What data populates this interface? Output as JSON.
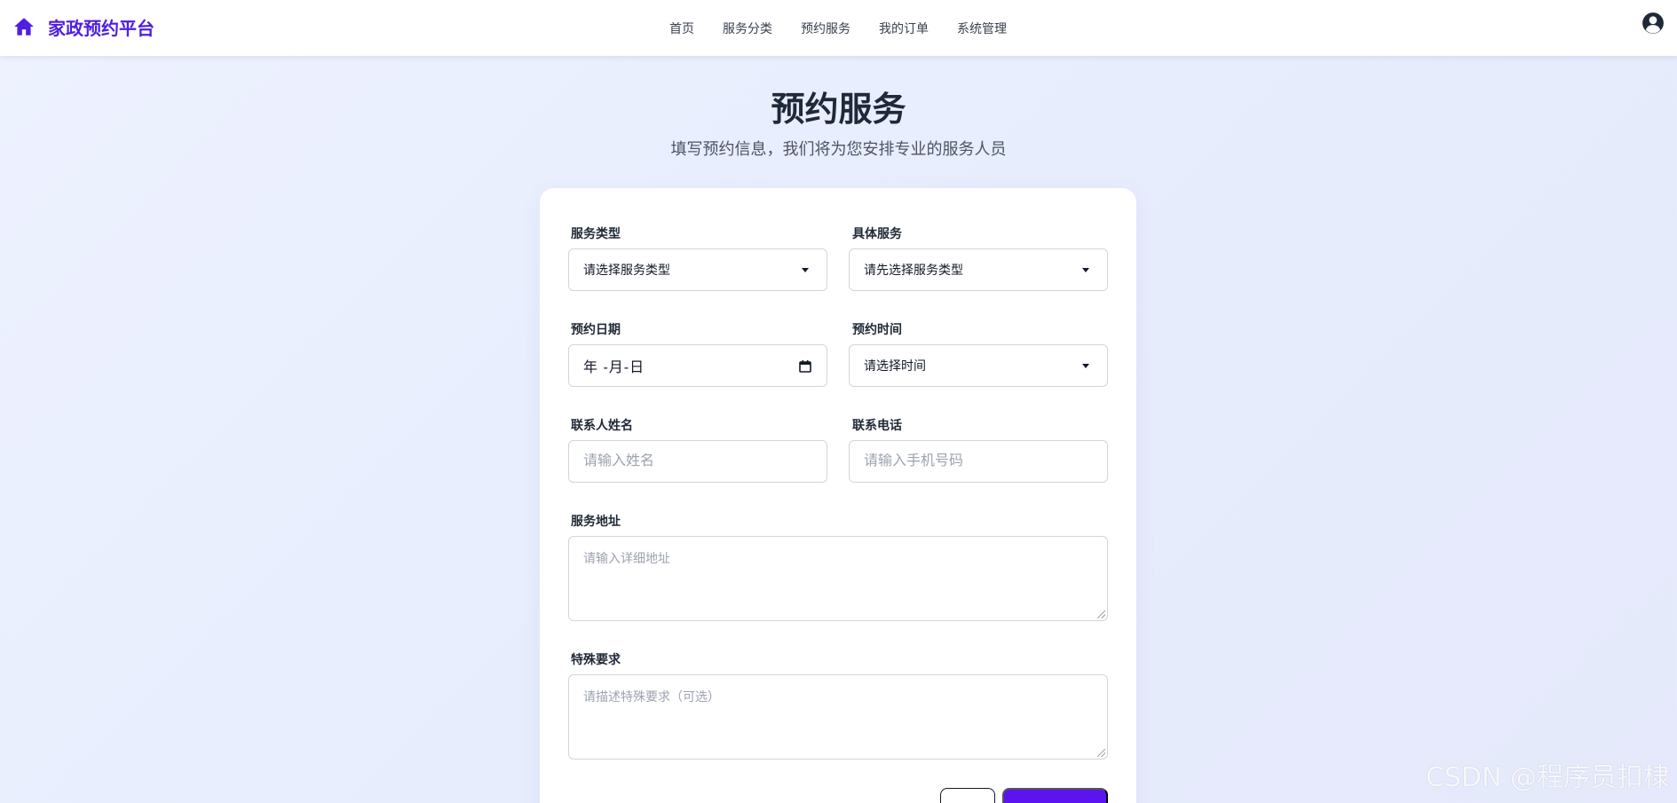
{
  "navbar": {
    "brand": "家政预约平台",
    "links": [
      "首页",
      "服务分类",
      "预约服务",
      "我的订单",
      "系统管理"
    ],
    "brand_color": "#4f1fe0"
  },
  "hero": {
    "title": "预约服务",
    "subtitle": "填写预约信息，我们将为您安排专业的服务人员"
  },
  "form": {
    "service_type": {
      "label": "服务类型",
      "value": "请选择服务类型"
    },
    "specific_service": {
      "label": "具体服务",
      "value": "请先选择服务类型"
    },
    "date": {
      "label": "预约日期",
      "value": "年 -月-日"
    },
    "time": {
      "label": "预约时间",
      "value": "请选择时间"
    },
    "contact_name": {
      "label": "联系人姓名",
      "placeholder": "请输入姓名"
    },
    "contact_phone": {
      "label": "联系电话",
      "placeholder": "请输入手机号码"
    },
    "address": {
      "label": "服务地址",
      "placeholder": "请输入详细地址"
    },
    "requirements": {
      "label": "特殊要求",
      "placeholder": "请描述特殊要求（可选）"
    },
    "submit_color": "#5b14ef"
  },
  "watermark": "CSDN @程序员扣棣"
}
